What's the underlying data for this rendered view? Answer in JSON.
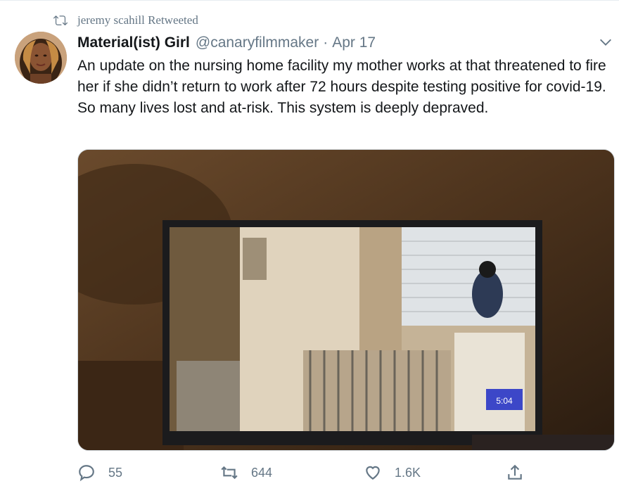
{
  "retweet": {
    "icon": "retweet-icon",
    "text": "jeremy scahill Retweeted"
  },
  "author": {
    "name": "Material(ist) Girl",
    "handle": "@canaryfilmmaker",
    "separator": "·",
    "date": "Apr 17"
  },
  "tweet": {
    "text": "An update on the nursing home facility my mother works at that threatened to fire her if she didn’t return to work after 72 hours despite testing positive for covid-19. So many lives lost and at-risk. This system is deeply depraved."
  },
  "media": {
    "overlay_time": "5:04"
  },
  "actions": {
    "reply": {
      "icon": "reply-icon",
      "count": "55"
    },
    "retweet": {
      "icon": "retweet-icon",
      "count": "644"
    },
    "like": {
      "icon": "heart-icon",
      "count": "1.6K"
    },
    "share": {
      "icon": "share-icon"
    }
  },
  "colors": {
    "muted": "#657786",
    "text": "#14171a",
    "background": "#ffffff"
  }
}
